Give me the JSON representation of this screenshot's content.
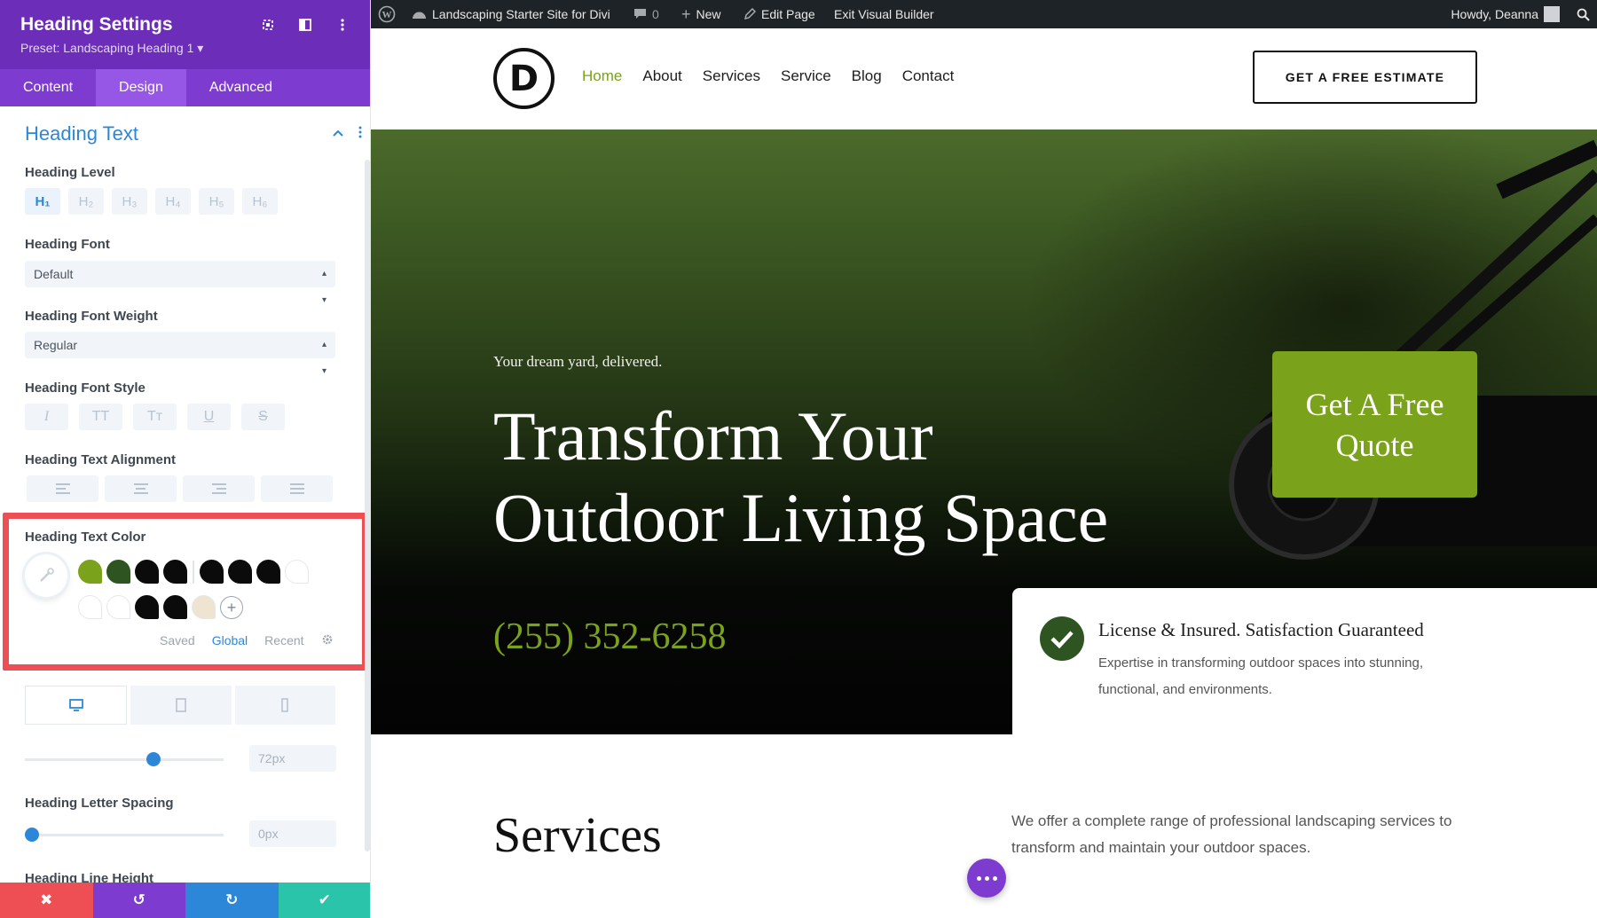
{
  "panel": {
    "title": "Heading Settings",
    "preset": "Preset: Landscaping Heading 1 ▾",
    "tabs": [
      "Content",
      "Design",
      "Advanced"
    ],
    "active_tab": "Design",
    "section_title": "Heading Text",
    "heading_level": {
      "label": "Heading Level",
      "options": [
        "H₁",
        "H₂",
        "H₃",
        "H₄",
        "H₅",
        "H₆"
      ],
      "selected": "H₁"
    },
    "heading_font": {
      "label": "Heading Font",
      "value": "Default"
    },
    "heading_font_weight": {
      "label": "Heading Font Weight",
      "value": "Regular"
    },
    "heading_font_style": {
      "label": "Heading Font Style",
      "options": [
        "I",
        "TT",
        "Tт",
        "U",
        "S"
      ]
    },
    "heading_text_alignment": {
      "label": "Heading Text Alignment"
    },
    "heading_text_color": {
      "label": "Heading Text Color",
      "swatches_row1": [
        "#7aa21a",
        "#2e5521",
        "#0b0b0b",
        "#0b0b0b",
        "#0b0b0b",
        "#0b0b0b",
        "#0b0b0b",
        "#ffffff"
      ],
      "swatches_row2": [
        "#ffffff",
        "#ffffff",
        "#0b0b0b",
        "#0b0b0b",
        "#efe3d2"
      ],
      "tabs": [
        "Saved",
        "Global",
        "Recent"
      ],
      "active_tab": "Global"
    },
    "heading_text_size": {
      "value": "72px",
      "level": 0.66
    },
    "heading_letter_spacing": {
      "label": "Heading Letter Spacing",
      "value": "0px",
      "level": 0.0
    },
    "heading_line_height": {
      "label": "Heading Line Height"
    },
    "bottom_buttons": [
      "✖",
      "↺",
      "↻",
      "✔"
    ],
    "colors": {
      "header": "#6c2eb9",
      "tabs": "#7e3bd0",
      "accent": "#2d87d8",
      "highlight_border": "#ee4f55"
    }
  },
  "wpbar": {
    "site_name": "Landscaping Starter Site for Divi",
    "comments": "0",
    "new_label": "New",
    "edit_page": "Edit Page",
    "exit_builder": "Exit Visual Builder",
    "greeting": "Howdy, Deanna"
  },
  "site": {
    "logo_letter": "D",
    "nav": [
      "Home",
      "About",
      "Services",
      "Service",
      "Blog",
      "Contact"
    ],
    "active_nav": "Home",
    "estimate_button": "GET A FREE ESTIMATE",
    "hero_sub": "Your dream yard, delivered.",
    "hero_title": "Transform Your Outdoor Living Space",
    "quote_button": "Get A Free Quote",
    "phone": "(255) 352-6258",
    "feature_title": "License & Insured. Satisfaction Guaranteed",
    "feature_desc": "Expertise in transforming outdoor spaces into stunning, functional, and environments.",
    "services_title": "Services",
    "services_desc": "We offer a complete range of professional landscaping services to transform and maintain your outdoor spaces.",
    "colors": {
      "brand_green": "#7aa21a",
      "dark_green": "#2e5521",
      "fab_purple": "#7e3bd0"
    }
  }
}
